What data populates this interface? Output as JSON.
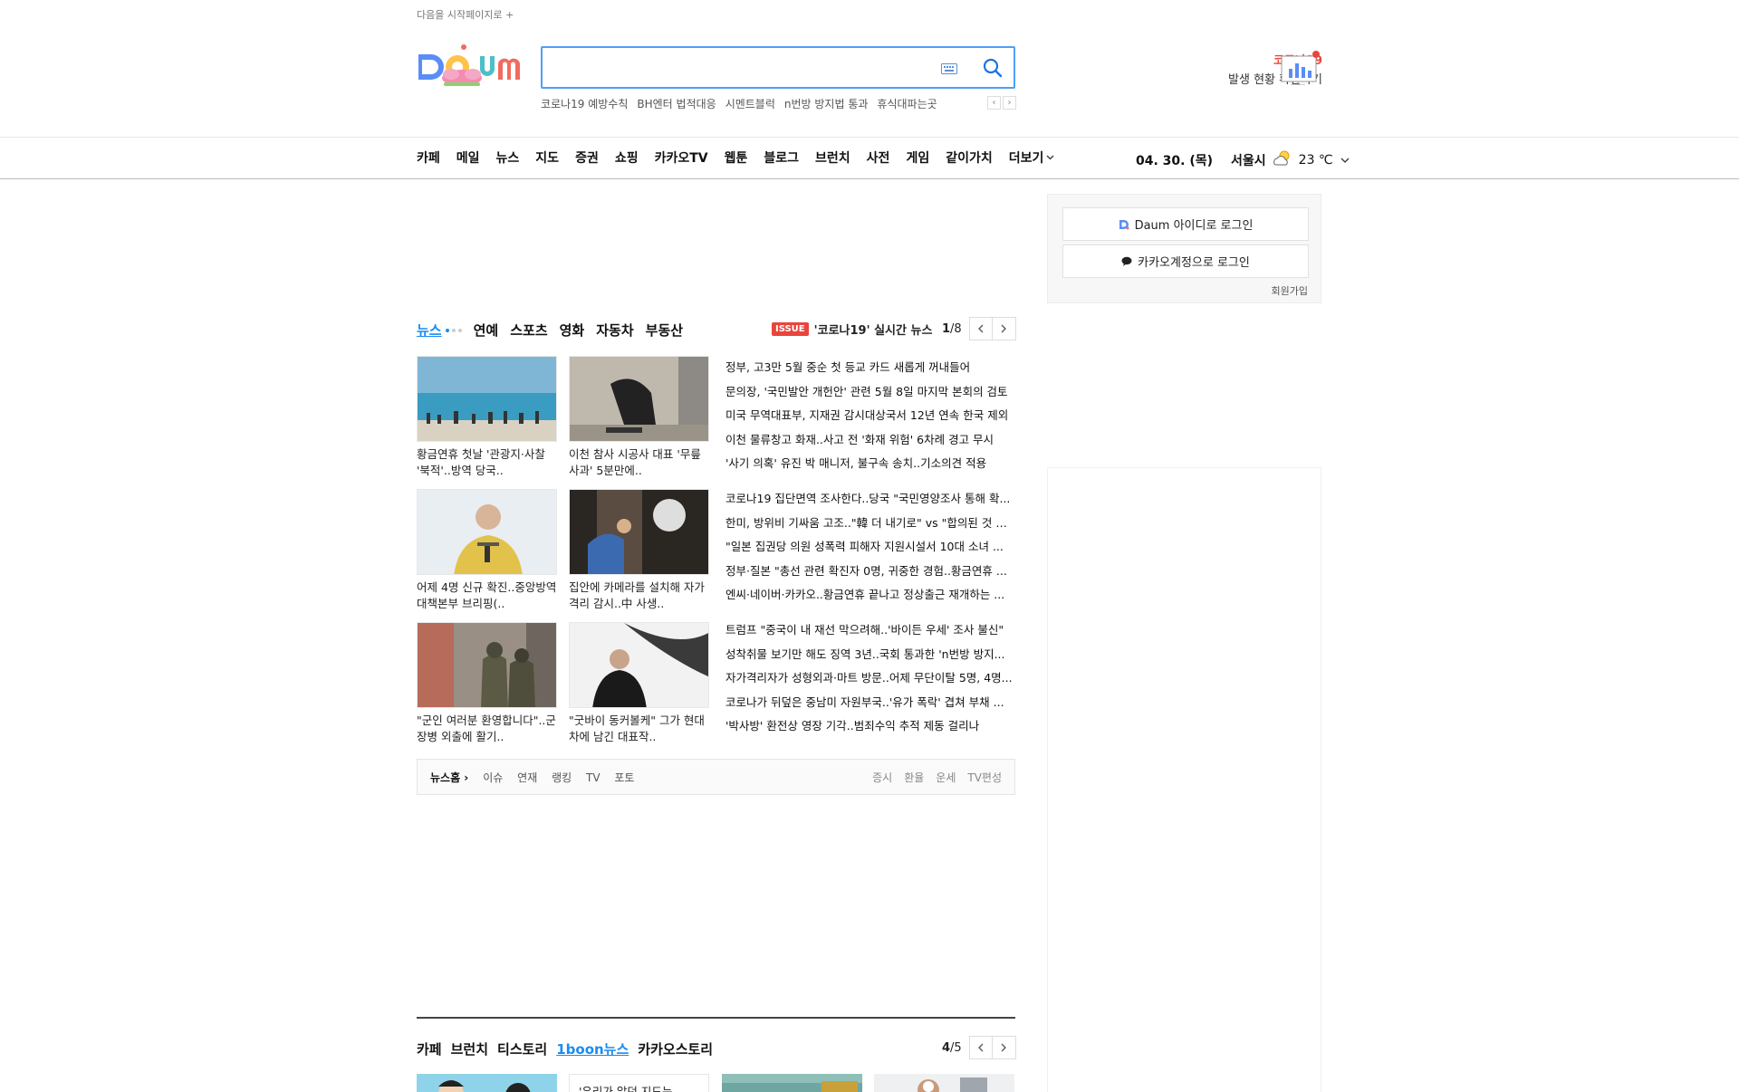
{
  "header": {
    "start_page": "다음을 시작페이지로 +",
    "search_placeholder": "",
    "trends": [
      "코로나19 예방수칙",
      "BH엔터 법적대응",
      "시멘트블럭",
      "n번방 방지법 통과",
      "휴식대파는곳"
    ],
    "covid_title": "코로나19",
    "covid_sub": "발생 현황 확인하기"
  },
  "gnb": {
    "items": [
      "카페",
      "메일",
      "뉴스",
      "지도",
      "증권",
      "쇼핑",
      "카카오TV",
      "웹툰",
      "블로그",
      "브런치",
      "사전",
      "게임",
      "같이가치"
    ],
    "more": "더보기"
  },
  "weather": {
    "date": "04. 30. (목)",
    "city": "서울시",
    "temp": "23 ℃"
  },
  "login": {
    "daum_login": "Daum 아이디로 로그인",
    "kakao_login": "카카오계정으로 로그인",
    "signup": "회원가입"
  },
  "news": {
    "tabs": [
      "뉴스",
      "연예",
      "스포츠",
      "영화",
      "자동차",
      "부동산"
    ],
    "issue_badge": "ISSUE",
    "issue_title": "'코로나19' 실시간 뉴스",
    "page_current": "1",
    "page_total": "/8",
    "thumbs": [
      "황금연휴 첫날 '관광지·사찰 '북적'..방역 당국..",
      "이천 참사 시공사 대표 '무릎 사과' 5분만에..",
      "어제 4명 신규 확진..중앙방역대책본부 브리핑(..",
      "집안에 카메라를 설치해 자가격리 감시..中 사생..",
      "\"군인 여러분 환영합니다\"..군장병 외출에 활기..",
      "\"굿바이 동커볼케\" 그가 현대차에 남긴 대표작.."
    ],
    "headlines_1": [
      "정부, 고3만 5월 중순 첫 등교 카드 새롭게 꺼내들어",
      "문의장, '국민발안 개헌안' 관련 5월 8일 마지막 본회의 검토",
      "미국 무역대표부, 지재권 감시대상국서 12년 연속 한국 제외",
      "이천 물류창고 화재..사고 전 '화재 위험' 6차례 경고 무시",
      "'사기 의혹' 유진 박 매니저, 불구속 송치..기소의견 적용"
    ],
    "headlines_2": [
      "코로나19 집단면역 조사한다..당국 \"국민영양조사 통해 확...",
      "한미, 방위비 기싸움 고조..\"韓 더 내기로\" vs \"합의된 것 없...",
      "\"일본 집권당 의원 성폭력 피해자 지원시설서 10대 소녀 ...",
      "정부·질본 \"총선 관련 확진자 0명, 귀중한 경험..황금연휴 ...",
      "엔씨·네이버·카카오..황금연휴 끝나고 정상출근 재개하는 ..."
    ],
    "headlines_3": [
      "트럼프 \"중국이 내 재선 막으려해..'바이든 우세' 조사 불신\"",
      "성착취물 보기만 해도 징역 3년..국회 통과한 'n번방 방지...",
      "자가격리자가 성형외과·마트 방문..어제 무단이탈 5명, 4명...",
      "코로나가 뒤덮은 중남미 자원부국..'유가 폭락' 겹쳐 부채 ...",
      "'박사방' 환전상 영장 기각..범죄수익 추적 제동 걸리나"
    ],
    "footer": {
      "home": "뉴스홈",
      "links": [
        "이슈",
        "연재",
        "랭킹",
        "TV",
        "포토"
      ],
      "right": [
        "증시",
        "환율",
        "운세",
        "TV편성"
      ]
    }
  },
  "section2": {
    "tabs": [
      "카페",
      "브런치",
      "티스토리",
      "1boon뉴스",
      "카카오스토리"
    ],
    "active": "1boon뉴스",
    "page_current": "4",
    "page_total": "/5",
    "text_card": "'우리가 알던 지도는"
  },
  "colors": {
    "accent": "#1a8cf0",
    "covid": "#e8453c",
    "search_border": "#4e9ff6"
  }
}
